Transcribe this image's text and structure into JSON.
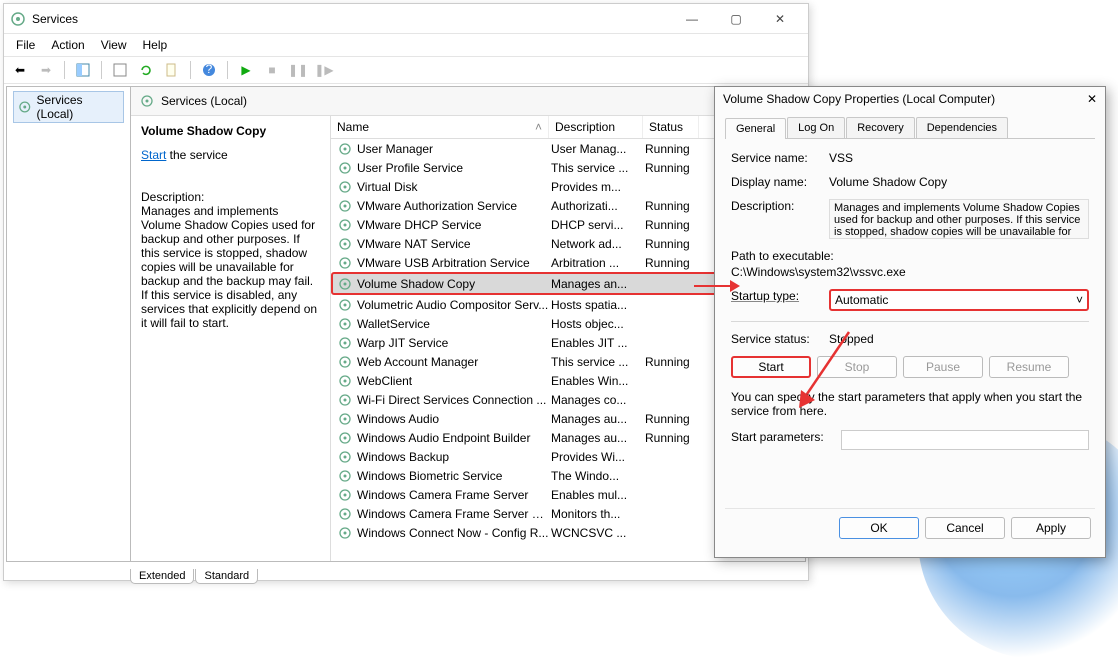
{
  "services": {
    "title": "Services",
    "menus": [
      "File",
      "Action",
      "View",
      "Help"
    ],
    "left_item": "Services (Local)",
    "header": "Services (Local)",
    "selected_name": "Volume Shadow Copy",
    "start_link": "Start",
    "start_suffix": " the service",
    "desc_label": "Description:",
    "desc_text": "Manages and implements Volume Shadow Copies used for backup and other purposes. If this service is stopped, shadow copies will be unavailable for backup and the backup may fail. If this service is disabled, any services that explicitly depend on it will fail to start.",
    "columns": {
      "name": "Name",
      "desc": "Description",
      "status": "Status"
    },
    "rows": [
      {
        "name": "User Manager",
        "desc": "User Manag...",
        "status": "Running"
      },
      {
        "name": "User Profile Service",
        "desc": "This service ...",
        "status": "Running"
      },
      {
        "name": "Virtual Disk",
        "desc": "Provides m...",
        "status": ""
      },
      {
        "name": "VMware Authorization Service",
        "desc": "Authorizati...",
        "status": "Running"
      },
      {
        "name": "VMware DHCP Service",
        "desc": "DHCP servi...",
        "status": "Running"
      },
      {
        "name": "VMware NAT Service",
        "desc": "Network ad...",
        "status": "Running"
      },
      {
        "name": "VMware USB Arbitration Service",
        "desc": "Arbitration ...",
        "status": "Running"
      },
      {
        "name": "Volume Shadow Copy",
        "desc": "Manages an...",
        "status": "",
        "hl": true
      },
      {
        "name": "Volumetric Audio Compositor Serv...",
        "desc": "Hosts spatia...",
        "status": ""
      },
      {
        "name": "WalletService",
        "desc": "Hosts objec...",
        "status": ""
      },
      {
        "name": "Warp JIT Service",
        "desc": "Enables JIT ...",
        "status": ""
      },
      {
        "name": "Web Account Manager",
        "desc": "This service ...",
        "status": "Running"
      },
      {
        "name": "WebClient",
        "desc": "Enables Win...",
        "status": ""
      },
      {
        "name": "Wi-Fi Direct Services Connection ...",
        "desc": "Manages co...",
        "status": ""
      },
      {
        "name": "Windows Audio",
        "desc": "Manages au...",
        "status": "Running"
      },
      {
        "name": "Windows Audio Endpoint Builder",
        "desc": "Manages au...",
        "status": "Running"
      },
      {
        "name": "Windows Backup",
        "desc": "Provides Wi...",
        "status": ""
      },
      {
        "name": "Windows Biometric Service",
        "desc": "The Windo...",
        "status": ""
      },
      {
        "name": "Windows Camera Frame Server",
        "desc": "Enables mul...",
        "status": ""
      },
      {
        "name": "Windows Camera Frame Server M...",
        "desc": "Monitors th...",
        "status": ""
      },
      {
        "name": "Windows Connect Now - Config R...",
        "desc": "WCNCSVC ...",
        "status": ""
      }
    ],
    "bottom_tabs": [
      "Extended",
      "Standard"
    ]
  },
  "props": {
    "title": "Volume Shadow Copy Properties (Local Computer)",
    "tabs": [
      "General",
      "Log On",
      "Recovery",
      "Dependencies"
    ],
    "labels": {
      "service_name": "Service name:",
      "display_name": "Display name:",
      "description": "Description:",
      "path": "Path to executable:",
      "startup_type": "Startup type:",
      "service_status": "Service status:",
      "start_params": "Start parameters:"
    },
    "values": {
      "service_name": "VSS",
      "display_name": "Volume Shadow Copy",
      "description": "Manages and implements Volume Shadow Copies used for backup and other purposes. If this service is stopped, shadow copies will be unavailable for",
      "path": "C:\\Windows\\system32\\vssvc.exe",
      "startup_type": "Automatic",
      "service_status": "Stopped",
      "hint": "You can specify the start parameters that apply when you start the service from here."
    },
    "buttons": {
      "start": "Start",
      "stop": "Stop",
      "pause": "Pause",
      "resume": "Resume"
    },
    "footer": {
      "ok": "OK",
      "cancel": "Cancel",
      "apply": "Apply"
    }
  }
}
